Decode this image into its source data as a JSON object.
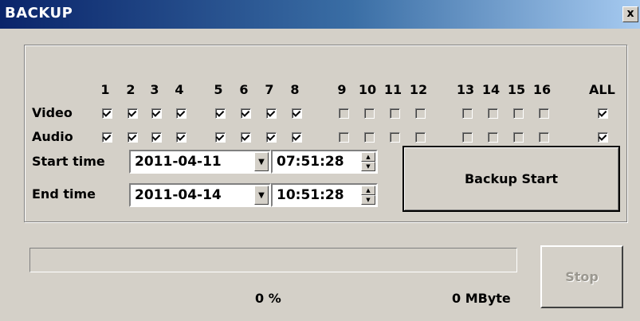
{
  "window": {
    "title": "BACKUP",
    "close_label": "x"
  },
  "channels": {
    "headers": [
      "1",
      "2",
      "3",
      "4",
      "5",
      "6",
      "7",
      "8",
      "9",
      "10",
      "11",
      "12",
      "13",
      "14",
      "15",
      "16",
      "ALL"
    ],
    "video_label": "Video",
    "audio_label": "Audio",
    "video_checked": [
      true,
      true,
      true,
      true,
      true,
      true,
      true,
      true,
      false,
      false,
      false,
      false,
      false,
      false,
      false,
      false,
      true
    ],
    "audio_checked": [
      true,
      true,
      true,
      true,
      true,
      true,
      true,
      true,
      false,
      false,
      false,
      false,
      false,
      false,
      false,
      false,
      true
    ]
  },
  "time": {
    "start_label": "Start time",
    "end_label": "End time",
    "start_date": "2011-04-11",
    "start_time": "07:51:28",
    "end_date": "2011-04-14",
    "end_time": "10:51:28"
  },
  "buttons": {
    "backup_start": "Backup Start",
    "stop": "Stop"
  },
  "progress": {
    "percent_text": "0 %",
    "size_text": "0 MByte",
    "fraction": 0
  },
  "icons": {
    "close": "close-icon",
    "dropdown": "chevron-down-icon",
    "spin": "spin-arrows-icon"
  }
}
